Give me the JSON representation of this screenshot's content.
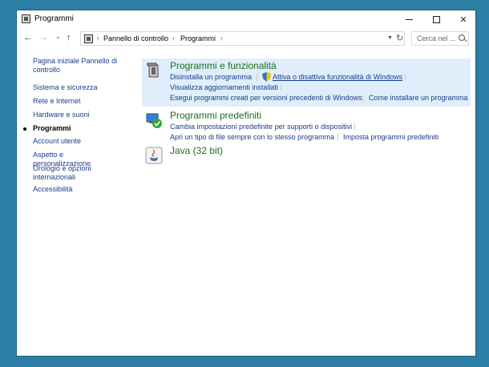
{
  "window": {
    "title": "Programmi"
  },
  "nav": {
    "back": "←",
    "forward": "→",
    "recent": "⌄",
    "up": "↑",
    "refresh": "↻"
  },
  "address": {
    "crumbs": [
      "Pannello di controllo",
      "Programmi"
    ],
    "sep": "›"
  },
  "search": {
    "placeholder": "Cerca nel ..."
  },
  "sidebar": {
    "items": [
      {
        "label": "Pagina iniziale Pannello di controllo"
      },
      {
        "label": "Sistema e sicurezza"
      },
      {
        "label": "Rete e Internet"
      },
      {
        "label": "Hardware e suoni"
      },
      {
        "label": "Programmi"
      },
      {
        "label": "Account utente"
      },
      {
        "label": "Aspetto e personalizzazione"
      },
      {
        "label": "Orologio e opzioni internazionali"
      },
      {
        "label": "Accessibilità"
      }
    ]
  },
  "categories": [
    {
      "title": "Programmi e funzionalità",
      "links": [
        "Disinstalla un programma",
        "Attiva o disattiva funzionalità di Windows",
        "Visualizza aggiornamenti installati",
        "Esegui programmi creati per versioni precedenti di Windows",
        "Come installare un programma"
      ]
    },
    {
      "title": "Programmi predefiniti",
      "links": [
        "Cambia impostazioni predefinite per supporti o dispositivi",
        "Apri un tipo di file sempre con lo stesso programma",
        "Imposta programmi predefiniti"
      ]
    },
    {
      "title": "Java (32 bit)",
      "links": []
    }
  ]
}
